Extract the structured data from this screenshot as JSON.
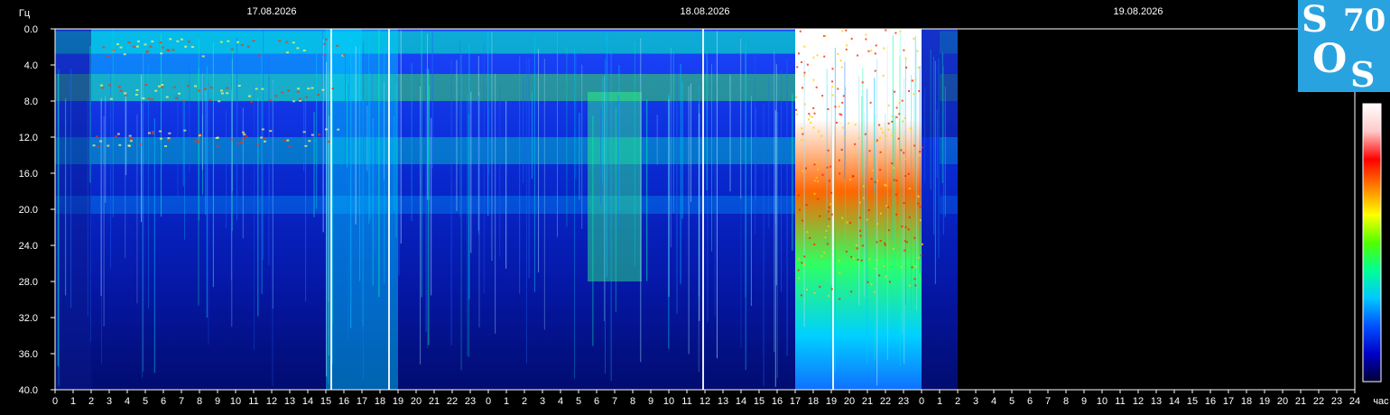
{
  "chart_data": {
    "type": "heatmap",
    "title": "",
    "ylabel": "Гц",
    "xlabel": "час",
    "ylim": [
      0,
      40
    ],
    "y_ticks": [
      "0.0",
      "4.0",
      "8.0",
      "12.0",
      "16.0",
      "20.0",
      "24.0",
      "28.0",
      "32.0",
      "36.0",
      "40.0"
    ],
    "x_ticks": [
      "0",
      "1",
      "2",
      "3",
      "4",
      "5",
      "6",
      "7",
      "8",
      "9",
      "10",
      "11",
      "12",
      "13",
      "14",
      "15",
      "16",
      "17",
      "18",
      "19",
      "20",
      "21",
      "22",
      "23",
      "0",
      "1",
      "2",
      "3",
      "4",
      "5",
      "6",
      "7",
      "8",
      "9",
      "10",
      "11",
      "12",
      "13",
      "14",
      "15",
      "16",
      "17",
      "18",
      "19",
      "20",
      "21",
      "22",
      "23",
      "0",
      "1",
      "2",
      "3",
      "4",
      "5",
      "6",
      "7",
      "8",
      "9",
      "10",
      "11",
      "12",
      "13",
      "14",
      "15",
      "16",
      "17",
      "18",
      "19",
      "20",
      "21",
      "22",
      "23",
      "24"
    ],
    "dates": [
      "17.08.2026",
      "18.08.2026",
      "19.08.2026"
    ],
    "data_end_hour": 50,
    "power_scale": [
      "#000033",
      "#0000c8",
      "#0050ff",
      "#00c8ff",
      "#00ff96",
      "#50ff00",
      "#ffff00",
      "#ff8000",
      "#ff0000",
      "#ffc8c8",
      "#ffffff"
    ],
    "regions": [
      {
        "hours": [
          0,
          2
        ],
        "freq": [
          0,
          40
        ],
        "level": 0.28
      },
      {
        "hours": [
          2,
          17
        ],
        "freq": [
          0,
          8
        ],
        "level": 0.5
      },
      {
        "hours": [
          15,
          19
        ],
        "freq": [
          0,
          40
        ],
        "level": 0.45
      },
      {
        "hours": [
          29.5,
          32.5
        ],
        "freq": [
          7,
          28
        ],
        "level": 0.55
      },
      {
        "hours": [
          41,
          48
        ],
        "freq": [
          0,
          40
        ],
        "level": 0.95
      },
      {
        "hours": [
          48,
          50
        ],
        "freq": [
          0,
          12
        ],
        "level": 0.4
      }
    ]
  },
  "logo": {
    "letters": [
      "S",
      "O",
      "S"
    ],
    "number": "70",
    "bg": "#29a3e0"
  }
}
